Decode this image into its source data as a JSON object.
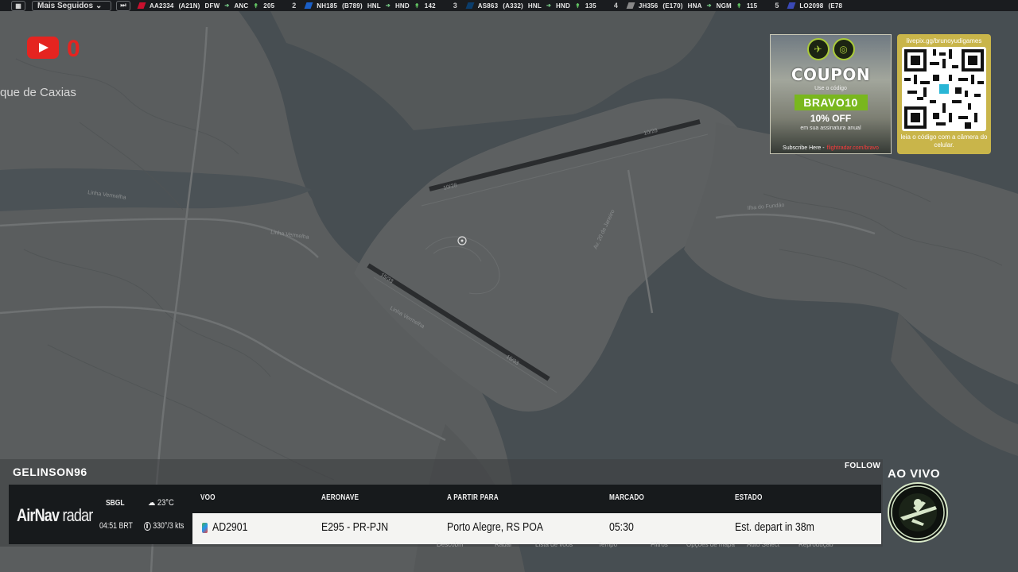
{
  "topbar": {
    "follow_label": "Mais Seguidos",
    "flights": [
      {
        "num": "",
        "callsign": "AA2334",
        "type": "(A21N)",
        "from": "DFW",
        "to": "ANC",
        "alt": "205",
        "color": "#c8102e"
      },
      {
        "num": "2",
        "callsign": "NH185",
        "type": "(B789)",
        "from": "HNL",
        "to": "HND",
        "alt": "142",
        "color": "#1a5fc7"
      },
      {
        "num": "3",
        "callsign": "AS863",
        "type": "(A332)",
        "from": "HNL",
        "to": "HND",
        "alt": "135",
        "color": "#0b3d6b"
      },
      {
        "num": "4",
        "callsign": "JH356",
        "type": "(E170)",
        "from": "HNA",
        "to": "NGM",
        "alt": "115",
        "color": "#888888"
      },
      {
        "num": "5",
        "callsign": "LO2098",
        "type": "(E78",
        "from": "",
        "to": "",
        "alt": "",
        "color": "#3a49b6"
      }
    ]
  },
  "youtube": {
    "count": "0"
  },
  "map": {
    "place_label": "que de Caxias",
    "runway_labels": [
      "10/28",
      "10/28",
      "15/33",
      "15/33"
    ],
    "road_labels": [
      "Linha Vermelha",
      "Linha Vermelha",
      "Linha Vermelha",
      "Av. 20 de Janeiro",
      "Ilha do Fundão"
    ]
  },
  "ad_coupon": {
    "title": "COUPON",
    "small1": "Use o código",
    "code": "BRAVO10",
    "off": "10% OFF",
    "small2": "em sua assinatura anual",
    "foot_a": "Subscribe Here -",
    "foot_b": "flightradar.com/bravo"
  },
  "ad_qr": {
    "url": "livepix.gg/brunoyudigames",
    "caption": "leia o código com a câmera do celular."
  },
  "stream": {
    "username": "GELINSON96",
    "follow_label": "FOLLOW",
    "live_label": "AO VIVO"
  },
  "info_panel": {
    "brand_a": "AirNav",
    "brand_b": "radar",
    "airport": "SBGL",
    "time": "04:51 BRT",
    "temperature": "23°C",
    "wind": "330°/3 kts",
    "headers": {
      "flight": "VOO",
      "aircraft": "AERONAVE",
      "route": "A PARTIR PARA",
      "scheduled": "MARCADO",
      "status": "ESTADO"
    },
    "row": {
      "flight": "AD2901",
      "aircraft": "E295 - PR-PJN",
      "route": "Porto Alegre, RS POA",
      "scheduled": "05:30",
      "status": "Est. depart in 38m"
    }
  },
  "ghost_nav": [
    "Descobrir",
    "Radar",
    "Lista de voos",
    "Tempo",
    "Filtros",
    "Opções de mapa",
    "Auto Select",
    "Reprodução"
  ],
  "colors": {
    "youtube_red": "#e52420",
    "coupon_green": "#79b71e",
    "qr_gold": "#c9b54a",
    "panel_dark": "#171a1c"
  }
}
